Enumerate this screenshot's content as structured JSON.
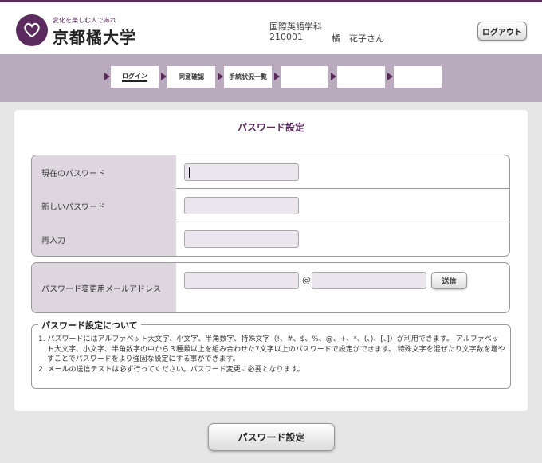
{
  "header": {
    "tagline": "変化を楽しむ人であれ",
    "university_name": "京都橘大学",
    "department": "国際英語学科",
    "student_id": "210001",
    "user_name": "橘　花子さん",
    "logout_label": "ログアウト"
  },
  "steps": [
    {
      "label": "ログイン",
      "active": true
    },
    {
      "label": "同意確認",
      "active": false
    },
    {
      "label": "手続状況一覧",
      "active": false
    },
    {
      "label": "",
      "active": false
    },
    {
      "label": "",
      "active": false
    },
    {
      "label": "",
      "active": false
    }
  ],
  "main": {
    "title": "パスワード設定",
    "fields": {
      "current_password_label": "現在のパスワード",
      "new_password_label": "新しいパスワード",
      "confirm_label": "再入力"
    },
    "mail": {
      "label": "パスワード変更用メールアドレス",
      "at_symbol": "@",
      "send_label": "送信"
    },
    "notes": {
      "legend": "パスワード設定について",
      "items": [
        "1. パスワードにはアルファベット大文字、小文字、半角数字、特殊文字（!、#、$、%、@、+、*、(、)、[、]）が利用できます。 アルファベット大文字、小文字、半角数字の中から３種類以上を組み合わせた7文字以上のパスワードで設定ができます。 特殊文字を混ぜたり文字数を増やすことでパスワードをより強固な設定にする事ができます。",
        "2. メールの送信テストは必ず行ってください。パスワード変更に必要となります。"
      ]
    },
    "submit_label": "パスワード設定"
  },
  "colors": {
    "brand": "#5b2a5e",
    "stepbar": "#b9abbd",
    "label_bg": "#ddd6df",
    "input_bg": "#ebe5ed"
  }
}
